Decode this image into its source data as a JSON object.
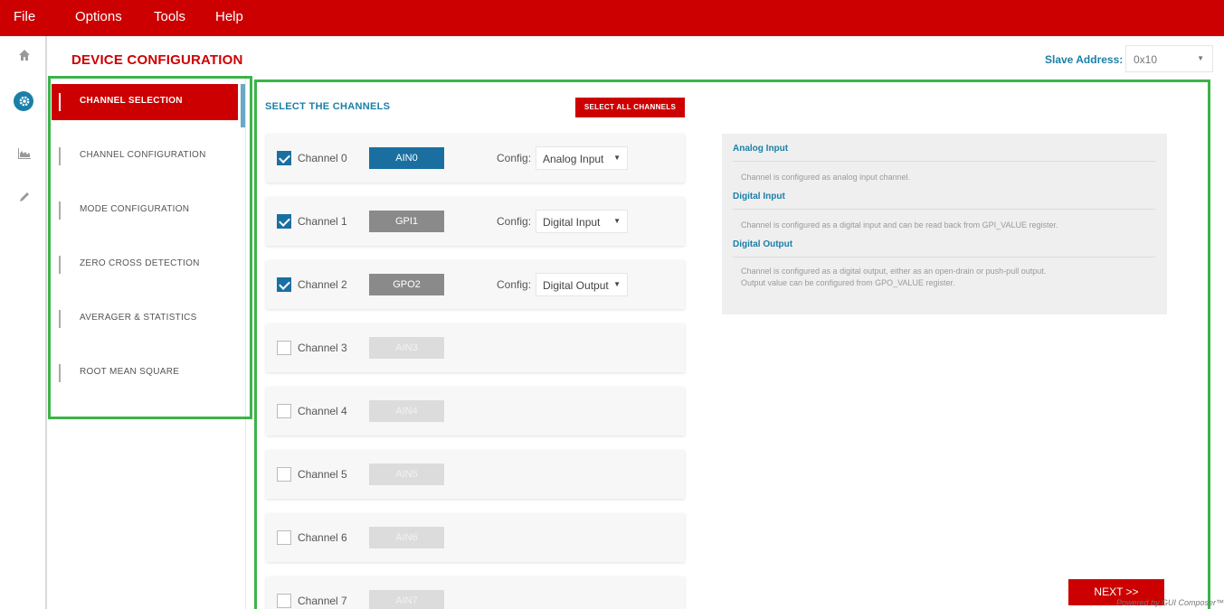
{
  "menu": {
    "items": [
      "File",
      "Options",
      "Tools",
      "Help"
    ]
  },
  "rail": {
    "icons": [
      "home-icon",
      "gear-icon",
      "chart-icon",
      "pencil-icon"
    ]
  },
  "header": {
    "title": "DEVICE CONFIGURATION",
    "slave_label": "Slave Address:",
    "slave_value": "0x10"
  },
  "sidebar": {
    "items": [
      {
        "label": "CHANNEL SELECTION",
        "active": true
      },
      {
        "label": "CHANNEL CONFIGURATION"
      },
      {
        "label": "MODE CONFIGURATION"
      },
      {
        "label": "ZERO CROSS DETECTION"
      },
      {
        "label": "AVERAGER & STATISTICS"
      },
      {
        "label": "ROOT MEAN SQUARE"
      }
    ]
  },
  "main": {
    "section_title": "SELECT THE CHANNELS",
    "select_all_label": "SELECT ALL CHANNELS",
    "config_label": "Config:",
    "channels": [
      {
        "label": "Channel 0",
        "checked": true,
        "pill": "AIN0",
        "pill_style": "blue",
        "config": "Analog Input"
      },
      {
        "label": "Channel 1",
        "checked": true,
        "pill": "GPI1",
        "pill_style": "gray",
        "config": "Digital Input"
      },
      {
        "label": "Channel 2",
        "checked": true,
        "pill": "GPO2",
        "pill_style": "gray",
        "config": "Digital Output"
      },
      {
        "label": "Channel 3",
        "checked": false,
        "pill": "AIN3",
        "pill_style": "light"
      },
      {
        "label": "Channel 4",
        "checked": false,
        "pill": "AIN4",
        "pill_style": "light"
      },
      {
        "label": "Channel 5",
        "checked": false,
        "pill": "AIN5",
        "pill_style": "light"
      },
      {
        "label": "Channel 6",
        "checked": false,
        "pill": "AIN6",
        "pill_style": "light"
      },
      {
        "label": "Channel 7",
        "checked": false,
        "pill": "AIN7",
        "pill_style": "light"
      }
    ]
  },
  "info": {
    "analog_title": "Analog Input",
    "analog_desc": "Channel is configured as analog input channel.",
    "digital_in_title": "Digital Input",
    "digital_in_desc": "Channel is configured as a digital input and can be read back from GPI_VALUE register.",
    "digital_out_title": "Digital Output",
    "digital_out_desc_1": "Channel is configured as a digital output, either as an open-drain or push-pull output.",
    "digital_out_desc_2": "Output value can be configured from GPO_VALUE register."
  },
  "footer": {
    "next_label": "NEXT >>",
    "powered": "Powered by GUI Composer™"
  },
  "colors": {
    "brand_red": "#cc0000",
    "accent_blue": "#1a7fa8",
    "highlight_green": "#3cb34a"
  }
}
